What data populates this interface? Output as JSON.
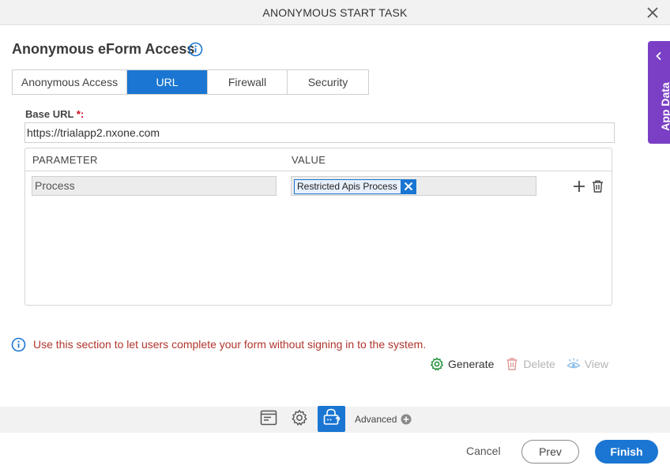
{
  "window": {
    "title": "ANONYMOUS START TASK"
  },
  "section": {
    "heading": "Anonymous eForm Access"
  },
  "tabs": [
    {
      "label": "Anonymous Access",
      "active": false
    },
    {
      "label": "URL",
      "active": true
    },
    {
      "label": "Firewall",
      "active": false
    },
    {
      "label": "Security",
      "active": false
    }
  ],
  "base_url": {
    "label": "Base URL",
    "required_mark": "*:",
    "value": "https://trialapp2.nxone.com"
  },
  "grid": {
    "headers": {
      "parameter": "PARAMETER",
      "value": "VALUE"
    },
    "rows": [
      {
        "parameter": "Process",
        "value_chip": "Restricted Apis Process"
      }
    ]
  },
  "note": {
    "text": "Use this section to let users complete your form without signing in to the system."
  },
  "actions": {
    "generate": "Generate",
    "delete": "Delete",
    "view": "View"
  },
  "footer": {
    "advanced": "Advanced"
  },
  "buttons": {
    "cancel": "Cancel",
    "prev": "Prev",
    "finish": "Finish"
  },
  "side_panel": {
    "label": "App Data"
  },
  "colors": {
    "primary": "#1a76d2",
    "note_text": "#b0352c",
    "side_panel": "#7b3fc6",
    "generate_icon": "#1f8f3a"
  }
}
